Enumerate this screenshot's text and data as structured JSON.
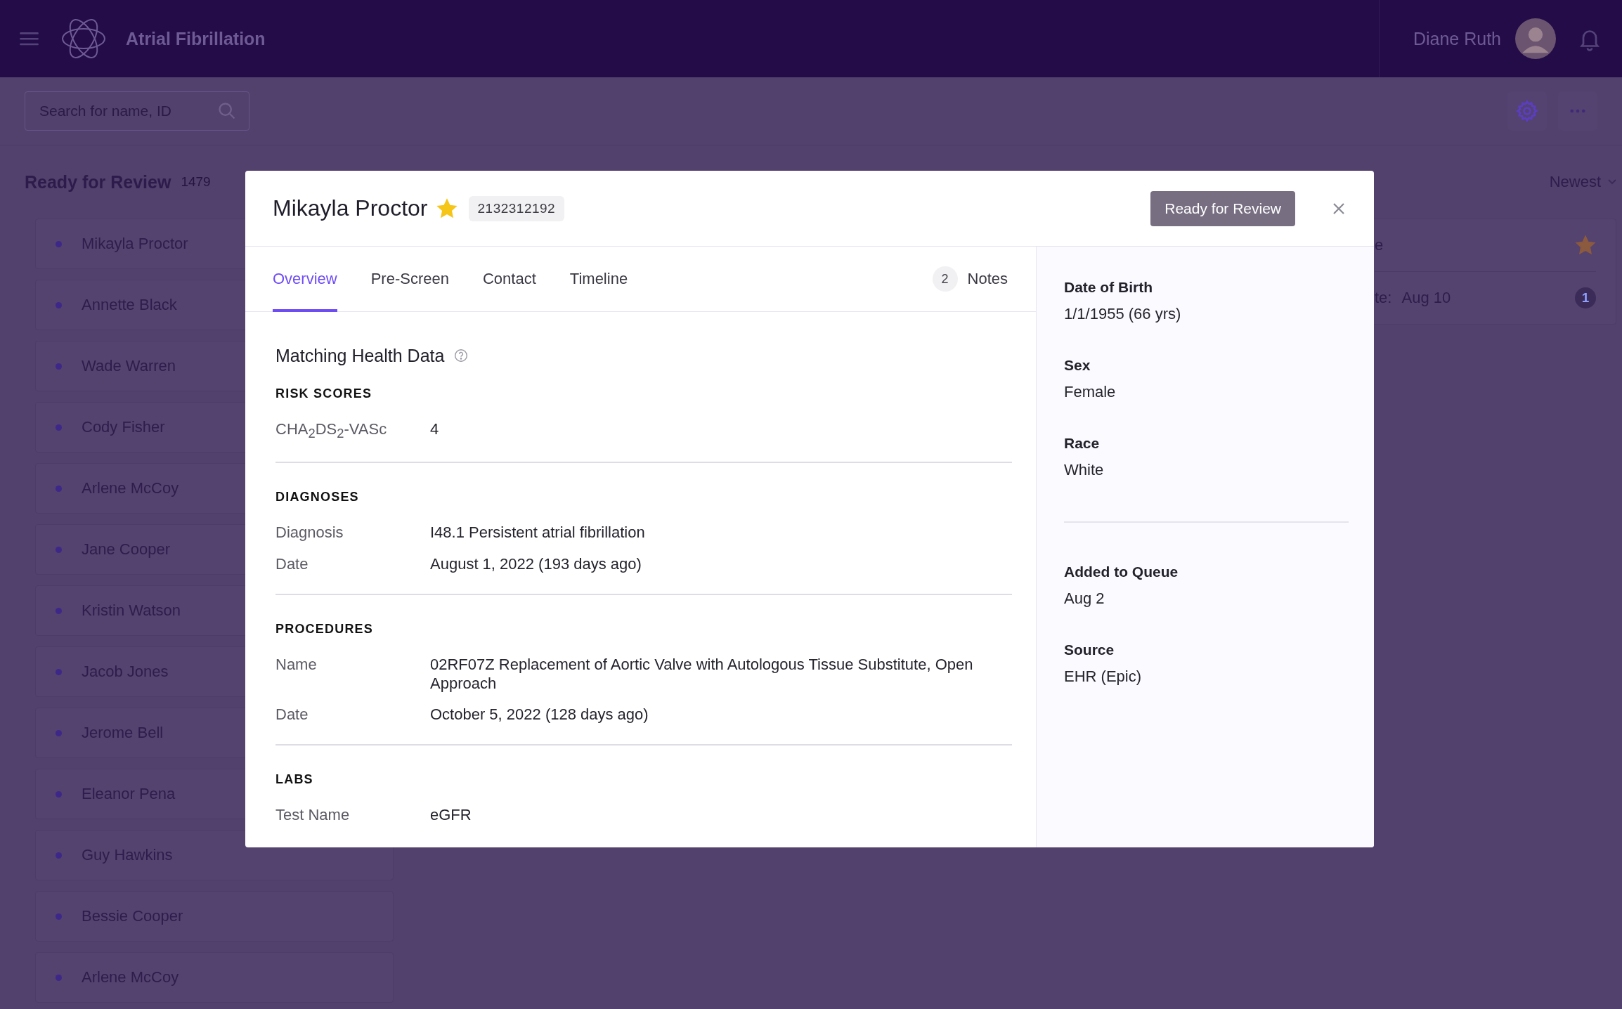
{
  "app_bar": {
    "title": "Atrial Fibrillation",
    "user_name": "Diane Ruth"
  },
  "toolbar": {
    "search": {
      "placeholder": "Search for name, ID"
    }
  },
  "queue": {
    "title": "Ready for Review",
    "count": "1479",
    "items": [
      {
        "name": "Mikayla Proctor"
      },
      {
        "name": "Annette Black"
      },
      {
        "name": "Wade Warren"
      },
      {
        "name": "Cody Fisher"
      },
      {
        "name": "Arlene McCoy"
      },
      {
        "name": "Jane Cooper"
      },
      {
        "name": "Kristin Watson"
      },
      {
        "name": "Jacob Jones"
      },
      {
        "name": "Jerome Bell"
      },
      {
        "name": "Eleanor Pena"
      },
      {
        "name": "Guy Hawkins"
      },
      {
        "name": "Bessie Cooper"
      },
      {
        "name": "Arlene McCoy"
      }
    ]
  },
  "sort": {
    "label": "Newest"
  },
  "background_card": {
    "title_fragment": "e",
    "starred": true,
    "date_label_fragment": "te:",
    "date": "Aug 10",
    "badge": "1"
  },
  "modal": {
    "patient_name": "Mikayla Proctor",
    "starred": true,
    "patient_id": "2132312192",
    "status_button": "Ready for Review",
    "tabs": [
      {
        "label": "Overview",
        "selected": true
      },
      {
        "label": "Pre-Screen",
        "selected": false
      },
      {
        "label": "Contact",
        "selected": false
      },
      {
        "label": "Timeline",
        "selected": false
      }
    ],
    "notes": {
      "count": "2",
      "label": "Notes"
    },
    "section_title": "Matching Health Data",
    "sections": [
      {
        "title": "RISK SCORES",
        "rows": [
          {
            "label": "CHA$_{2}$DS$_{2}$-VASc",
            "value": "4"
          }
        ]
      },
      {
        "title": "DIAGNOSES",
        "rows": [
          {
            "label": "Diagnosis",
            "value": "I48.1 Persistent atrial fibrillation"
          },
          {
            "label": "Date",
            "value": "August 1, 2022 (193 days ago)"
          }
        ]
      },
      {
        "title": "PROCEDURES",
        "rows": [
          {
            "label": "Name",
            "value": "02RF07Z Replacement of Aortic Valve with Autologous Tissue Substitute, Open Approach"
          },
          {
            "label": "Date",
            "value": "October 5, 2022 (128 days ago)"
          }
        ]
      },
      {
        "title": "LABS",
        "rows": [
          {
            "label": "Test Name",
            "value": "eGFR"
          }
        ]
      }
    ],
    "detail_groups": [
      {
        "items": [
          {
            "label": "Date of Birth",
            "value": "1/1/1955 (66 yrs)"
          },
          {
            "label": "Sex",
            "value": "Female"
          },
          {
            "label": "Race",
            "value": "White"
          }
        ]
      },
      {
        "items": [
          {
            "label": "Added to Queue",
            "value": "Aug 2"
          },
          {
            "label": "Source",
            "value": "EHR (Epic)"
          }
        ]
      }
    ]
  }
}
